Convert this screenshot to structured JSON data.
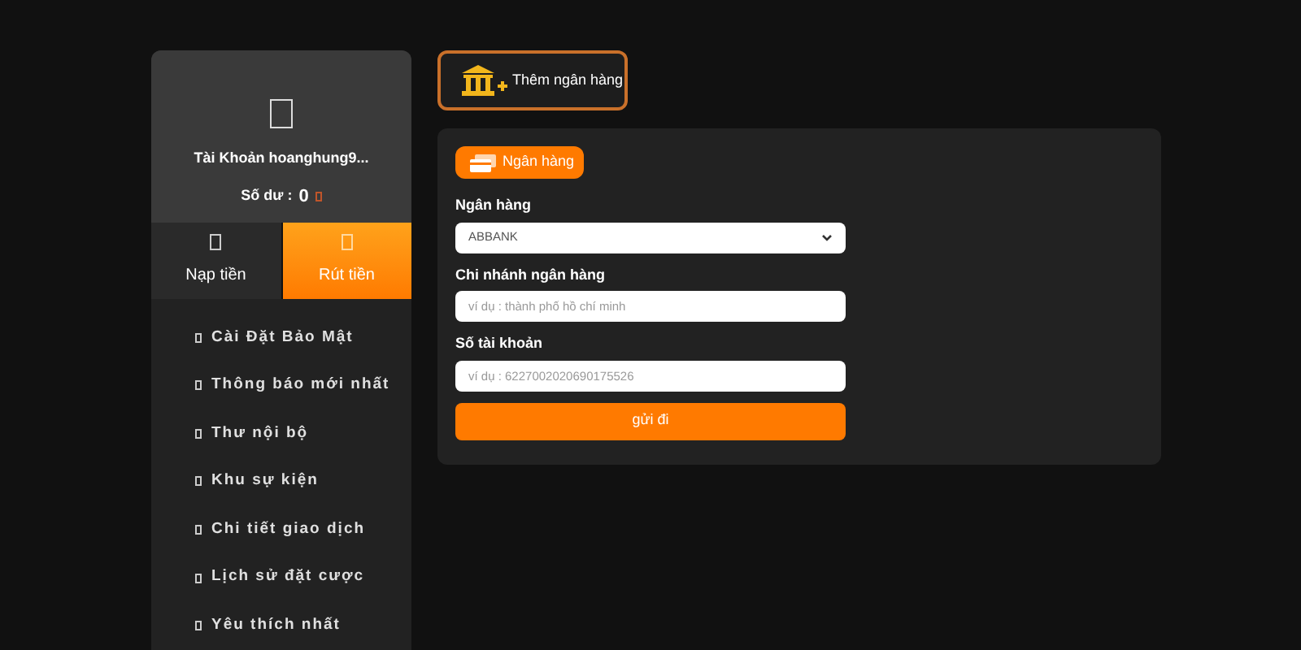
{
  "account": {
    "name": "Tài Khoản hoanghung9...",
    "balance_label": "Số dư :",
    "balance": "0"
  },
  "tabs": [
    {
      "label": "Nạp tiền",
      "selected": false
    },
    {
      "label": "Rút tiền",
      "selected": true
    }
  ],
  "menu": [
    "Cài Đặt Bảo Mật",
    "Thông báo mới nhất",
    "Thư nội bộ",
    "Khu sự kiện",
    "Chi tiết giao dịch",
    "Lịch sử đặt cược",
    "Yêu thích nhất"
  ],
  "add_bank_button": "Thêm ngân hàng",
  "form": {
    "section": "Ngân hàng",
    "fields": [
      {
        "kind": "select",
        "label": "Ngân hàng",
        "value": "ABBANK"
      },
      {
        "kind": "text",
        "label": "Chi nhánh ngân hàng",
        "placeholder": "ví dụ : thành phố hồ chí minh"
      },
      {
        "kind": "text",
        "label": "Số tài khoản",
        "placeholder": "ví dụ : 6227002020690175526"
      }
    ],
    "submit": "gửi đi"
  }
}
